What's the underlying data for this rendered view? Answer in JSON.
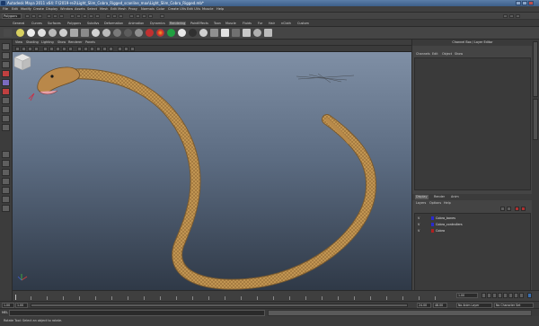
{
  "window": {
    "title": "Autodesk Maya 2011 x64: F:\\2019-re3\\Light_Slim_Cobra_Rigged_scanline_max\\Light_Slim_Cobra_Rigged.mb*"
  },
  "menubar": {
    "items": [
      "File",
      "Edit",
      "Modify",
      "Create",
      "Display",
      "Window",
      "Assets",
      "Select",
      "Mesh",
      "Edit Mesh",
      "Proxy",
      "Normals",
      "Color",
      "Create UVs",
      "Edit UVs",
      "Muscle",
      "Help"
    ]
  },
  "statusline": {
    "mode": "Polygons"
  },
  "shelf": {
    "tabs": [
      "General",
      "Curves",
      "Surfaces",
      "Polygons",
      "Subdivs",
      "Deformation",
      "Animation",
      "Dynamics",
      "Rendering",
      "PaintEffects",
      "Toon",
      "Muscle",
      "Fluids",
      "Fur",
      "Hair",
      "nCloth",
      "Custom"
    ],
    "active_tab": "Rendering"
  },
  "panel": {
    "menu": [
      "View",
      "Shading",
      "Lighting",
      "Show",
      "Renderer",
      "Panels"
    ]
  },
  "channel_box": {
    "title": "Channel Box / Layer Editor",
    "menu": [
      "Channels",
      "Edit",
      "Object",
      "Show"
    ]
  },
  "layer_editor": {
    "tabs": [
      "Display",
      "Render",
      "Anim"
    ],
    "active_tab": "Display",
    "menu": [
      "Layers",
      "Options",
      "Help"
    ],
    "layers": [
      {
        "visible": "V",
        "name": "Cobra_bones",
        "color": "#2a2ad0"
      },
      {
        "visible": "V",
        "name": "Cobra_controllers",
        "color": "#2a2ad0"
      },
      {
        "visible": "V",
        "name": "Cobra",
        "color": "#b02020"
      }
    ]
  },
  "right_tabs": [
    "Channel Box / Layer Editor",
    "Attribute Editor"
  ],
  "time": {
    "current_frame": "1.00",
    "range_start": "1.00",
    "range_inner_start": "1.00",
    "range_end_inner": "24.00",
    "range_end": "48.00",
    "anim_layer": "No Anim Layer",
    "character_set": "No Character Set"
  },
  "command": {
    "label": "MEL"
  },
  "helpline": {
    "text": "Rotate Tool: Select an object to rotate."
  },
  "colors": {
    "titlebar": "#4a6e99",
    "snake_body": "#b88a4a",
    "viewport_top": "#7f8fa5",
    "viewport_bottom": "#2f3947"
  }
}
